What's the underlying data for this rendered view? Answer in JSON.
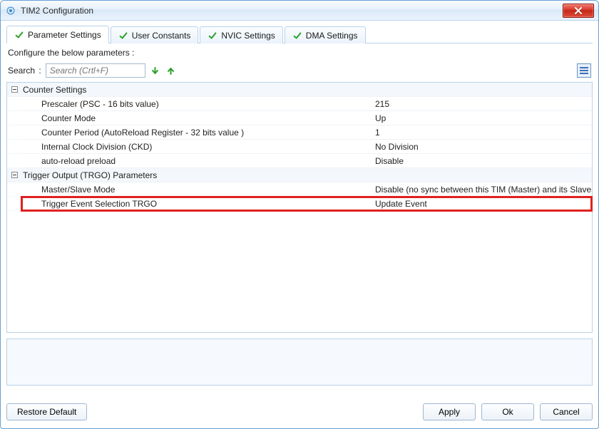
{
  "window": {
    "title": "TIM2 Configuration"
  },
  "tabs": [
    {
      "label": "Parameter Settings",
      "active": true
    },
    {
      "label": "User Constants",
      "active": false
    },
    {
      "label": "NVIC Settings",
      "active": false
    },
    {
      "label": "DMA Settings",
      "active": false
    }
  ],
  "instruction": "Configure the below parameters :",
  "search": {
    "label": "Search",
    "placeholder": "Search (Crtl+F)"
  },
  "groups": [
    {
      "name": "Counter Settings",
      "items": [
        {
          "label": "Prescaler (PSC - 16 bits value)",
          "value": "215"
        },
        {
          "label": "Counter Mode",
          "value": "Up"
        },
        {
          "label": "Counter Period (AutoReload Register - 32 bits value )",
          "value": "1"
        },
        {
          "label": "Internal Clock Division (CKD)",
          "value": "No Division"
        },
        {
          "label": "auto-reload preload",
          "value": "Disable"
        }
      ]
    },
    {
      "name": "Trigger Output (TRGO) Parameters",
      "items": [
        {
          "label": "Master/Slave Mode",
          "value": "Disable (no sync between this TIM (Master) and its Slaves"
        },
        {
          "label": "Trigger Event Selection TRGO",
          "value": "Update Event",
          "highlight": true
        }
      ]
    }
  ],
  "buttons": {
    "restore": "Restore Default",
    "apply": "Apply",
    "ok": "Ok",
    "cancel": "Cancel"
  },
  "icons": {
    "app": "gear-icon",
    "check": "check-icon",
    "close": "close-icon",
    "arrow_next": "arrow-down-green-icon",
    "arrow_prev": "arrow-up-green-icon",
    "list": "list-view-icon",
    "collapse": "minus-box-icon"
  }
}
